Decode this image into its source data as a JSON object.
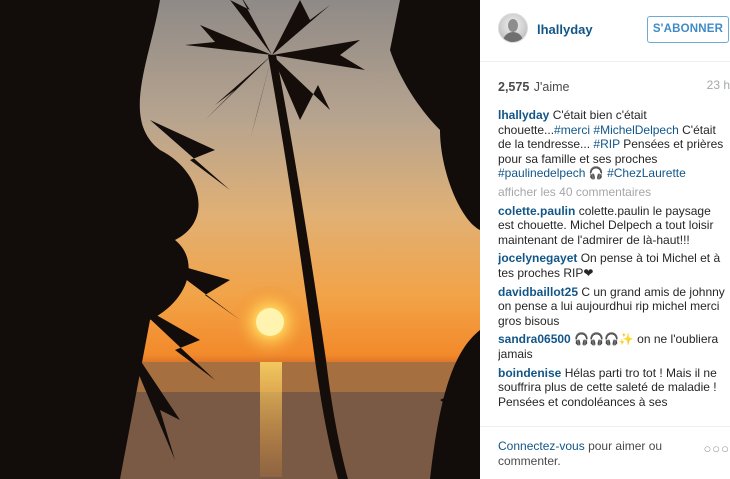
{
  "post": {
    "username": "lhallyday",
    "follow_label": "S'ABONNER",
    "likes_count": "2,575",
    "likes_label": "J'aime",
    "time": "23 h",
    "caption": {
      "username": "lhallyday",
      "text1": "C'était bien c'était chouette...",
      "tag1": "#merci",
      "tag2": "#MichelDelpech",
      "text2": "C'était de la tendresse...",
      "tag3": "#RIP",
      "text3": "Pensées et prières pour sa famille et ses proches",
      "tag4": "#paulinedelpech",
      "emoji": "🎧",
      "tag5": "#ChezLaurette"
    },
    "more_comments": "afficher les 40 commentaires",
    "comments": [
      {
        "user": "colette.paulin",
        "text": "colette.paulin le paysage est chouette. Michel Delpech a tout loisir maintenant de l'admirer de là-haut!!!"
      },
      {
        "user": "jocelynegayet",
        "text": "On pense à toi Michel et à tes proches RIP❤"
      },
      {
        "user": "davidbaillot25",
        "text": "C un grand amis de johnny on pense a lui aujourdhui rip michel merci gros bisous"
      },
      {
        "user": "sandra06500",
        "text": "🎧🎧🎧✨ on ne l'oubliera jamais"
      },
      {
        "user": "boindenise",
        "text": "Hélas parti tro tot ! Mais il ne souffrira plus de cette saleté de maladie ! Pensées et condoléances à ses"
      }
    ],
    "footer": {
      "connect_link": "Connectez-vous",
      "connect_text": "pour aimer ou commenter.",
      "more_icon": "ellipsis-icon",
      "more_glyph": "○○○"
    }
  }
}
